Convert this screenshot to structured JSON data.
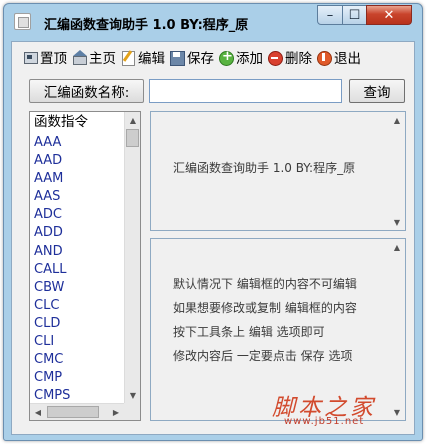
{
  "window": {
    "title": "汇编函数查询助手 1.0  BY:程序_原"
  },
  "titlebar": {
    "min_glyph": "–",
    "max_glyph": "☐",
    "close_glyph": "✕"
  },
  "toolbar": {
    "items": [
      {
        "label": "置顶",
        "icon": "pin-icon"
      },
      {
        "label": "主页",
        "icon": "home-icon"
      },
      {
        "label": "编辑",
        "icon": "edit-icon"
      },
      {
        "label": "保存",
        "icon": "save-icon"
      },
      {
        "label": "添加",
        "icon": "add-icon"
      },
      {
        "label": "删除",
        "icon": "delete-icon"
      },
      {
        "label": "退出",
        "icon": "exit-icon"
      }
    ]
  },
  "search": {
    "label": "汇编函数名称:",
    "value": "",
    "button_label": "查询"
  },
  "list": {
    "header": "函数指令",
    "items": [
      "AAA",
      "AAD",
      "AAM",
      "AAS",
      "ADC",
      "ADD",
      "AND",
      "CALL",
      "CBW",
      "CLC",
      "CLD",
      "CLI",
      "CMC",
      "CMP",
      "CMPS"
    ]
  },
  "scroll": {
    "up": "▲",
    "down": "▼",
    "left": "◀",
    "right": "▶"
  },
  "top_panel": {
    "text": "汇编函数查询助手 1.0  BY:程序_原"
  },
  "info_panel": {
    "lines": [
      "默认情况下 编辑框的内容不可编辑",
      "如果想要修改或复制 编辑框的内容",
      "按下工具条上 编辑 选项即可",
      "修改内容后 一定要点击 保存 选项"
    ]
  },
  "watermark": {
    "main": "脚本之家",
    "url": "www.jb51.net"
  },
  "colors": {
    "frame": "#aacfe8",
    "list_text": "#1e2f9a",
    "watermark": "#d24a2d"
  }
}
